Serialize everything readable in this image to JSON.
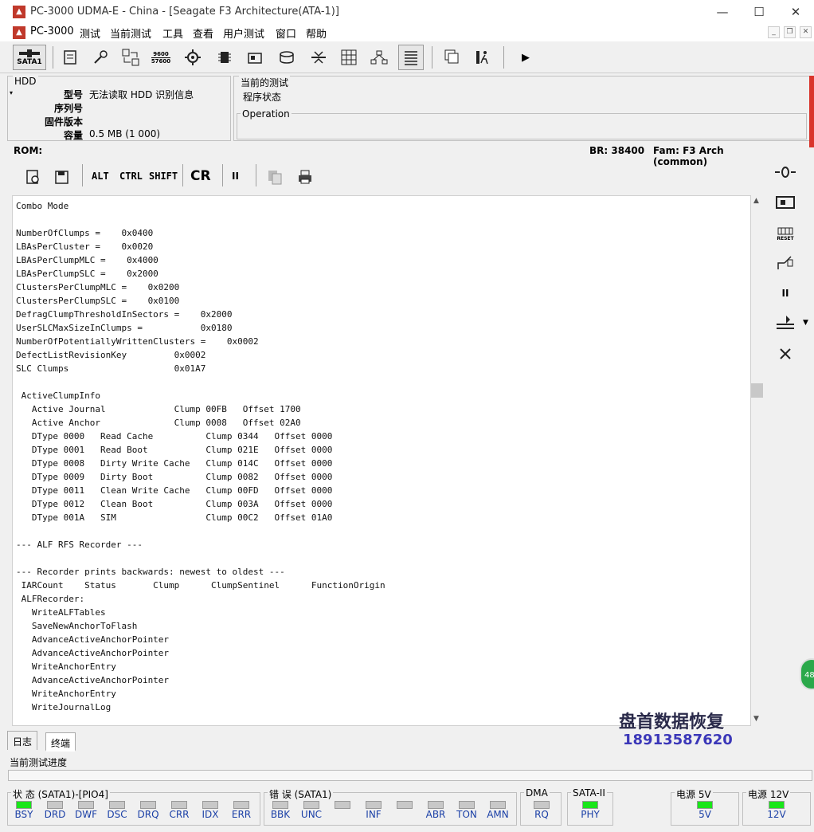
{
  "window": {
    "title": "PC-3000 UDMA-E - China - [Seagate F3 Architecture(ATA-1)]",
    "logo": "pc3000-logo",
    "controls": {
      "minimize": "—",
      "maximize": "☐",
      "close": "✕"
    }
  },
  "menu": {
    "items": [
      "PC-3000",
      "测试",
      "当前测试",
      "工具",
      "查看",
      "用户测试",
      "窗口",
      "帮助"
    ],
    "mdi_controls": {
      "minimize": "_",
      "restore": "❐",
      "close": "✕"
    }
  },
  "toolbar": {
    "sata_label": "SATA1",
    "baud_top": "9600",
    "baud_bottom": "57600"
  },
  "hdd": {
    "legend": "HDD",
    "fields": [
      {
        "label": "型号",
        "value": "无法读取 HDD 识别信息"
      },
      {
        "label": "序列号",
        "value": ""
      },
      {
        "label": "固件版本",
        "value": ""
      },
      {
        "label": "容量",
        "value": "0.5 MB (1 000)"
      }
    ]
  },
  "current_test": {
    "legend": "当前的测试",
    "status": "程序状态",
    "operation_legend": "Operation"
  },
  "rom_bar": {
    "rom": "ROM:",
    "br": "BR: 38400",
    "fam": "Fam: F3 Arch (common)"
  },
  "inner_toolbar": {
    "alt": "ALT",
    "ctrl": "CTRL",
    "shift": "SHIFT",
    "cr": "CR",
    "pause": "II"
  },
  "terminal": {
    "lines": [
      "Combo Mode",
      "",
      "NumberOfClumps =    0x0400",
      "LBAsPerCluster =    0x0020",
      "LBAsPerClumpMLC =    0x4000",
      "LBAsPerClumpSLC =    0x2000",
      "ClustersPerClumpMLC =    0x0200",
      "ClustersPerClumpSLC =    0x0100",
      "DefragClumpThresholdInSectors =    0x2000",
      "UserSLCMaxSizeInClumps =           0x0180",
      "NumberOfPotentiallyWrittenClusters =    0x0002",
      "DefectListRevisionKey         0x0002",
      "SLC Clumps                    0x01A7",
      "",
      " ActiveClumpInfo",
      "   Active Journal             Clump 00FB   Offset 1700",
      "   Active Anchor              Clump 0008   Offset 02A0",
      "   DType 0000   Read Cache          Clump 0344   Offset 0000",
      "   DType 0001   Read Boot           Clump 021E   Offset 0000",
      "   DType 0008   Dirty Write Cache   Clump 014C   Offset 0000",
      "   DType 0009   Dirty Boot          Clump 0082   Offset 0000",
      "   DType 0011   Clean Write Cache   Clump 00FD   Offset 0000",
      "   DType 0012   Clean Boot          Clump 003A   Offset 0000",
      "   DType 001A   SIM                 Clump 00C2   Offset 01A0",
      "",
      "--- ALF RFS Recorder ---",
      "",
      "--- Recorder prints backwards: newest to oldest ---",
      " IARCount    Status       Clump      ClumpSentinel      FunctionOrigin",
      " ALFRecorder:",
      "   WriteALFTables",
      "   SaveNewAnchorToFlash",
      "   AdvanceActiveAnchorPointer",
      "   AdvanceActiveAnchorPointer",
      "   WriteAnchorEntry",
      "   AdvanceActiveAnchorPointer",
      "   WriteAnchorEntry",
      "   WriteJournalLog"
    ]
  },
  "right_toolbar": {
    "reset_label": "RESET"
  },
  "tabs": [
    {
      "label": "日志"
    },
    {
      "label": "终端",
      "active": true
    }
  ],
  "progress": {
    "label": "当前测试进度"
  },
  "status_groups": {
    "state": {
      "title": "状 态 (SATA1)-[PIO4]",
      "leds": [
        {
          "label": "BSY",
          "on": true
        },
        {
          "label": "DRD",
          "on": false
        },
        {
          "label": "DWF",
          "on": false
        },
        {
          "label": "DSC",
          "on": false
        },
        {
          "label": "DRQ",
          "on": false
        },
        {
          "label": "CRR",
          "on": false
        },
        {
          "label": "IDX",
          "on": false
        },
        {
          "label": "ERR",
          "on": false
        }
      ]
    },
    "error": {
      "title": "错 误 (SATA1)",
      "leds": [
        {
          "label": "BBK",
          "on": false
        },
        {
          "label": "UNC",
          "on": false
        },
        {
          "label": "",
          "on": false
        },
        {
          "label": "INF",
          "on": false
        },
        {
          "label": "",
          "on": false
        },
        {
          "label": "ABR",
          "on": false
        },
        {
          "label": "TON",
          "on": false
        },
        {
          "label": "AMN",
          "on": false
        }
      ]
    },
    "dma": {
      "title": "DMA",
      "leds": [
        {
          "label": "RQ",
          "on": false
        }
      ]
    },
    "sata": {
      "title": "SATA-II",
      "leds": [
        {
          "label": "PHY",
          "on": true
        }
      ]
    },
    "p5": {
      "title": "电源 5V",
      "leds": [
        {
          "label": "5V",
          "on": true
        }
      ]
    },
    "p12": {
      "title": "电源 12V",
      "leds": [
        {
          "label": "12V",
          "on": true
        }
      ]
    }
  },
  "watermark": {
    "line1": "盘首数据恢复",
    "line2": "18913587620"
  },
  "badge": {
    "text": "48"
  },
  "colors": {
    "led_on": "#19e619",
    "led_label": "#1a3fa6",
    "accent_red": "#d9342b"
  }
}
